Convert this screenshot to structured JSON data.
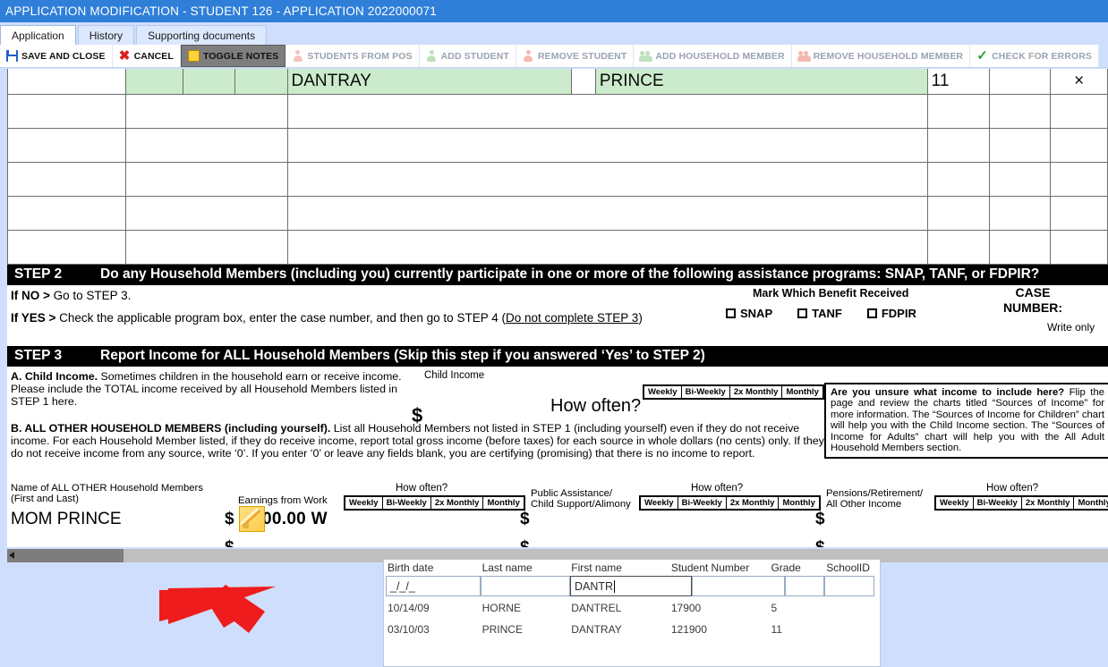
{
  "window": {
    "title": "APPLICATION MODIFICATION - STUDENT 126 - APPLICATION 2022000071"
  },
  "tabs": [
    {
      "label": "Application",
      "active": true
    },
    {
      "label": "History",
      "active": false
    },
    {
      "label": "Supporting documents",
      "active": false
    }
  ],
  "toolbar": [
    {
      "label": "SAVE AND CLOSE",
      "icon": "save-icon",
      "state": "enabled"
    },
    {
      "label": "CANCEL",
      "icon": "close-icon",
      "state": "enabled"
    },
    {
      "label": "TOGGLE NOTES",
      "icon": "note-icon",
      "state": "pressed"
    },
    {
      "label": "STUDENTS FROM POS",
      "icon": "person-icon",
      "state": "disabled"
    },
    {
      "label": "ADD STUDENT",
      "icon": "person-add-icon",
      "state": "disabled"
    },
    {
      "label": "REMOVE STUDENT",
      "icon": "person-remove-icon",
      "state": "disabled"
    },
    {
      "label": "ADD HOUSEHOLD MEMBER",
      "icon": "people-add-icon",
      "state": "disabled"
    },
    {
      "label": "REMOVE HOUSEHOLD MEMBER",
      "icon": "people-remove-icon",
      "state": "disabled"
    },
    {
      "label": "CHECK FOR ERRORS",
      "icon": "check-icon",
      "state": "disabled"
    }
  ],
  "step1": {
    "rows": [
      {
        "first_name": "DANTRAY",
        "last_name": "PRINCE",
        "grade": "11",
        "delete": "×",
        "highlighted": true
      },
      {
        "first_name": "",
        "last_name": "",
        "grade": "",
        "delete": "",
        "highlighted": false
      },
      {
        "first_name": "",
        "last_name": "",
        "grade": "",
        "delete": "",
        "highlighted": false
      },
      {
        "first_name": "",
        "last_name": "",
        "grade": "",
        "delete": "",
        "highlighted": false
      },
      {
        "first_name": "",
        "last_name": "",
        "grade": "",
        "delete": "",
        "highlighted": false
      },
      {
        "first_name": "",
        "last_name": "",
        "grade": "",
        "delete": "",
        "highlighted": false
      }
    ]
  },
  "step2": {
    "banner_step": "STEP 2",
    "banner_text": "Do any Household Members (including you) currently participate in one or more of the following assistance programs: SNAP, TANF, or FDPIR?",
    "if_no_bold": "If NO >",
    "if_no_text": " Go to STEP 3.",
    "if_yes_bold": "If YES >",
    "if_yes_text": " Check the applicable program box, enter the case number, and then go to STEP 4 (",
    "if_yes_link": "Do not complete STEP 3",
    "if_yes_tail": ")",
    "mark_which": "Mark Which Benefit Received",
    "benefits": [
      "SNAP",
      "TANF",
      "FDPIR"
    ],
    "case_number_label": "CASE\nNUMBER:",
    "case_number_line1": "CASE",
    "case_number_line2": "NUMBER:",
    "write_only": "Write only"
  },
  "step3": {
    "banner_step": "STEP 3",
    "banner_text": "Report Income for ALL Household Members (Skip this step if you answered ‘Yes’ to STEP 2)",
    "section_a_bold": "A. Child Income.",
    "section_a_text": " Sometimes children in the household earn or receive income. Please include the TOTAL income received by all Household Members listed in STEP 1 here.",
    "section_b_bold": "B. ALL OTHER HOUSEHOLD MEMBERS (including yourself).",
    "section_b_text": " List all Household Members not listed in STEP 1 (including yourself) even if they do not receive income. For each Household Member listed, if they do receive income, report total gross income (before taxes) for each source in whole dollars (no cents) only. If they do not receive income from any source, write ‘0’. If you enter ‘0’ or leave any fields blank, you are certifying (promising) that there is no income to report.",
    "child_income_label": "Child Income",
    "how_often_big": "How often?",
    "how_often_small": "How often?",
    "dollar_sign": "$",
    "frequencies": [
      "Weekly",
      "Bi-Weekly",
      "2x Monthly",
      "Monthly"
    ],
    "infobox_bold": "Are you unsure what income to include here?",
    "infobox_text": " Flip the page and review the charts titled “Sources of Income” for more information. The “Sources of Income for Children” chart will help you with the Child Income section. The “Sources of Income for Adults” chart will help you with the All Adult Household Members section.",
    "name_label_line1": "Name of ALL OTHER Household Members",
    "name_label_line2": "(First and Last)",
    "earnings_label": "Earnings from Work",
    "public_assist_line1": "Public Assistance/",
    "public_assist_line2": "Child Support/Alimony",
    "pensions_line1": "Pensions/Retirement/",
    "pensions_line2": "All Other Income",
    "member_name": "MOM PRINCE",
    "earnings_amount": "00.00 W",
    "note_icon": "note-icon"
  },
  "search": {
    "columns": [
      "Birth date",
      "Last name",
      "First name",
      "Student Number",
      "Grade",
      "SchoolID"
    ],
    "filters": {
      "birth_date": "_/_/_",
      "last_name": "",
      "first_name": "DANTR",
      "student_number": "",
      "grade": "",
      "school_id": ""
    },
    "results": [
      {
        "birth_date": "10/14/09",
        "last_name": "HORNE",
        "first_name": "DANTREL",
        "student_number": "17900",
        "grade": "5",
        "school_id": ""
      },
      {
        "birth_date": "03/10/03",
        "last_name": "PRINCE",
        "first_name": "DANTRAY",
        "student_number": "121900",
        "grade": "11",
        "school_id": ""
      }
    ]
  },
  "annotation": {
    "arrow": "red-arrow-pointer"
  },
  "colors": {
    "titlebar": "#2f7fd8",
    "app_background": "#cfdefc",
    "highlight_row": "#ccebcc",
    "arrow": "#ee1c1c"
  }
}
